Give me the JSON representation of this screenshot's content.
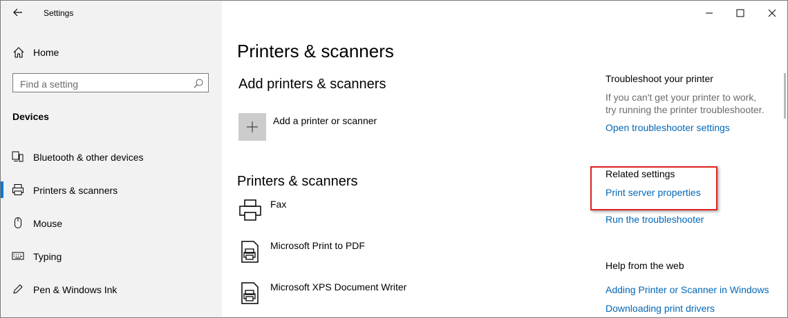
{
  "window": {
    "title": "Settings"
  },
  "sidebar": {
    "home": "Home",
    "search_placeholder": "Find a setting",
    "section": "Devices",
    "items": [
      {
        "label": "Bluetooth & other devices",
        "icon": "bluetooth-icon"
      },
      {
        "label": "Printers & scanners",
        "icon": "printer-icon",
        "selected": true
      },
      {
        "label": "Mouse",
        "icon": "mouse-icon"
      },
      {
        "label": "Typing",
        "icon": "keyboard-icon"
      },
      {
        "label": "Pen & Windows Ink",
        "icon": "pen-icon"
      }
    ]
  },
  "main": {
    "title": "Printers & scanners",
    "add_heading": "Add printers & scanners",
    "add_button": "Add a printer or scanner",
    "list_heading": "Printers & scanners",
    "printers": [
      {
        "name": "Fax",
        "icon": "fax-icon"
      },
      {
        "name": "Microsoft Print to PDF",
        "icon": "printer-doc-icon"
      },
      {
        "name": "Microsoft XPS Document Writer",
        "icon": "printer-doc-icon"
      }
    ]
  },
  "right": {
    "troubleshoot_heading": "Troubleshoot your printer",
    "troubleshoot_line1": "If you can't get your printer to work,",
    "troubleshoot_line2": "try running the printer troubleshooter.",
    "troubleshoot_link": "Open troubleshooter settings",
    "related_heading": "Related settings",
    "related_link1": "Print server properties",
    "related_link2": "Run the troubleshooter",
    "help_heading": "Help from the web",
    "help_link1": "Adding Printer or Scanner in Windows",
    "help_link2": "Downloading print drivers"
  },
  "colors": {
    "accent": "#0067b8",
    "sidebar_bg": "#f2f2f2",
    "highlight": "#e0211f",
    "selection": "#0078d7"
  }
}
